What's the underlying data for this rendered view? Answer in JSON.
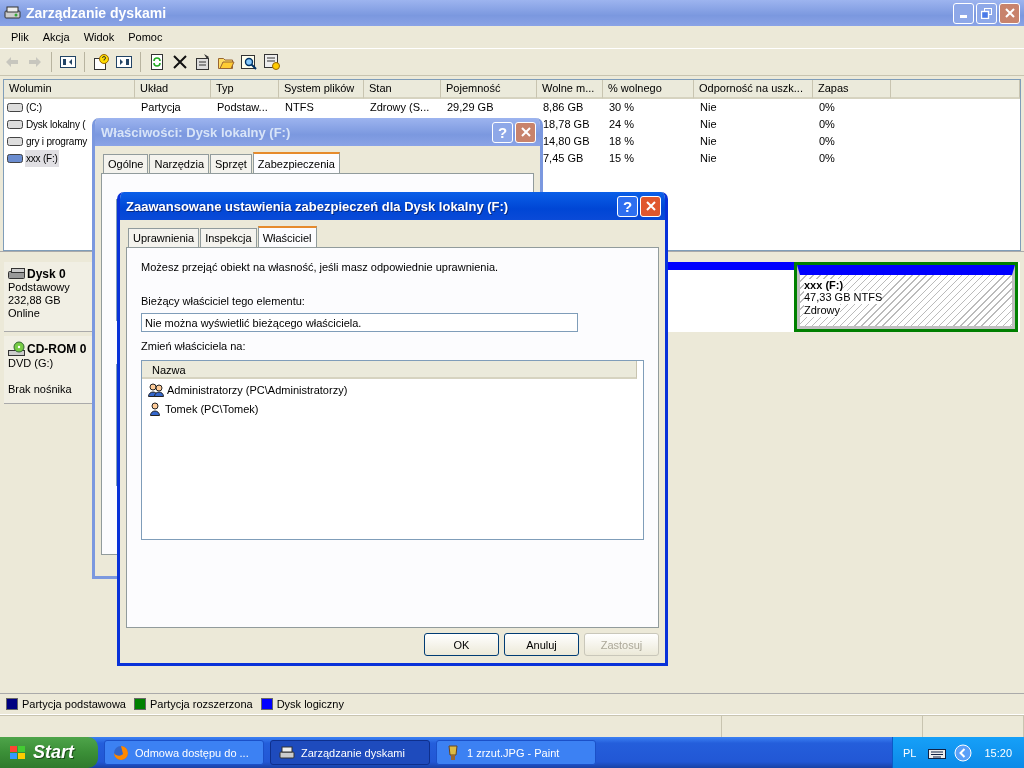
{
  "window": {
    "title": "Zarządzanie dyskami",
    "active": false
  },
  "menu": [
    "Plik",
    "Akcja",
    "Widok",
    "Pomoc"
  ],
  "toolbar": [
    {
      "disabled": true
    },
    {
      "disabled": true
    },
    {
      "disabled": false
    },
    {
      "disabled": false
    },
    {
      "disabled": false
    },
    {
      "disabled": false
    },
    {
      "disabled": false
    },
    {
      "disabled": false
    },
    {
      "disabled": false
    },
    {
      "disabled": false
    },
    {
      "disabled": false
    }
  ],
  "table": {
    "columns": [
      "Wolumin",
      "Układ",
      "Typ",
      "System plików",
      "Stan",
      "Pojemność",
      "Wolne m...",
      "% wolnego",
      "Odporność na uszk...",
      "Zapas"
    ],
    "rows": [
      {
        "selected": false,
        "cells": [
          "(C:)",
          "Partycja",
          "Podstaw...",
          "NTFS",
          "Zdrowy (S...",
          "29,29 GB",
          "8,86 GB",
          "30 %",
          "Nie",
          "0%"
        ]
      },
      {
        "selected": false,
        "cells": [
          "Dysk lokalny (",
          null,
          null,
          null,
          null,
          null,
          "18,78 GB",
          "24 %",
          "Nie",
          "0%"
        ]
      },
      {
        "selected": false,
        "cells": [
          "gry i programy",
          null,
          null,
          null,
          null,
          null,
          "14,80 GB",
          "18 %",
          "Nie",
          "0%"
        ]
      },
      {
        "selected": true,
        "cells": [
          "xxx (F:)",
          null,
          null,
          null,
          null,
          null,
          "7,45 GB",
          "15 %",
          "Nie",
          "0%"
        ]
      }
    ]
  },
  "disks": [
    {
      "kind": "disk",
      "name": "Dysk 0",
      "type": "Podstawowy",
      "size": "232,88 GB",
      "status": "Online",
      "partitions": [
        {
          "name": "xxx  (F:)",
          "size": "47,33 GB NTFS",
          "status": "Zdrowy"
        }
      ]
    },
    {
      "kind": "cdrom",
      "name": "CD-ROM 0",
      "type": "DVD (G:)",
      "status": "Brak nośnika"
    }
  ],
  "legend": [
    {
      "label": "Partycja podstawowa",
      "color": "#000080"
    },
    {
      "label": "Partycja rozszerzona",
      "color": "#008000"
    },
    {
      "label": "Dysk logiczny",
      "color": "#0000ff"
    }
  ],
  "properties_dialog": {
    "title": "Właściwości: Dysk lokalny (F:)",
    "active": false,
    "help_button": "?",
    "tabs": [
      {
        "label": "Ogólne",
        "selected": false
      },
      {
        "label": "Narzędzia",
        "selected": false
      },
      {
        "label": "Sprzęt",
        "selected": false
      },
      {
        "label": "Zabezpieczenia",
        "selected": true
      }
    ]
  },
  "advanced_dialog": {
    "title": "Zaawansowane ustawienia zabezpieczeń dla Dysk lokalny (F:)",
    "active": true,
    "help_button": "?",
    "tabs": [
      {
        "label": "Uprawnienia",
        "selected": false
      },
      {
        "label": "Inspekcja",
        "selected": false
      },
      {
        "label": "Właściciel",
        "selected": true
      }
    ],
    "intro": "Możesz przejąć obiekt na własność, jeśli masz odpowiednie uprawnienia.",
    "current_owner_label": "Bieżący właściciel tego elementu:",
    "current_owner": "Nie można wyświetlić bieżącego właściciela.",
    "change_owner_label": "Zmień właściciela na:",
    "list_header": "Nazwa",
    "owners": [
      {
        "kind": "group",
        "name": "Administratorzy (PC\\Administratorzy)",
        "selected": false
      },
      {
        "kind": "user",
        "name": "Tomek (PC\\Tomek)",
        "selected": false
      }
    ],
    "buttons": [
      {
        "label": "OK",
        "disabled": false
      },
      {
        "label": "Anuluj",
        "disabled": false
      },
      {
        "label": "Zastosuj",
        "disabled": true
      }
    ]
  },
  "taskbar": {
    "start": "Start",
    "tasks": [
      {
        "label": "Odmowa dostępu do ...",
        "selected": false
      },
      {
        "label": "Zarządzanie dyskami",
        "selected": true
      },
      {
        "label": "1 zrzut.JPG - Paint",
        "selected": false
      }
    ],
    "language": "PL",
    "clock": "15:20"
  }
}
